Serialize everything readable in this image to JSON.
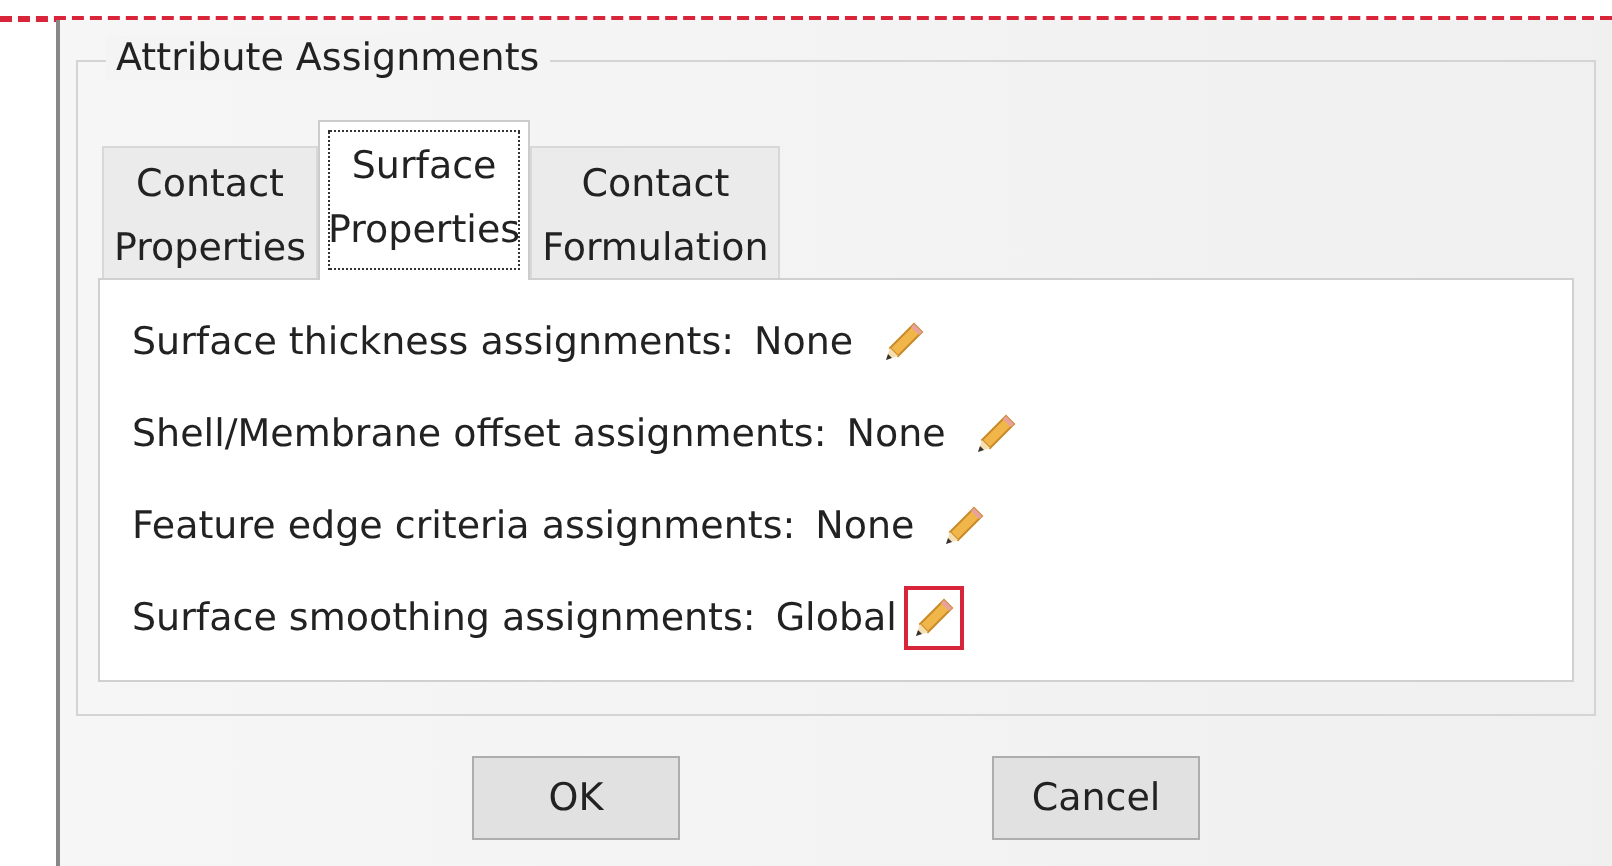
{
  "group": {
    "title": "Attribute Assignments"
  },
  "tabs": [
    {
      "label": "Contact\nProperties",
      "selected": false
    },
    {
      "label": "Surface\nProperties",
      "selected": true
    },
    {
      "label": "Contact\nFormulation",
      "selected": false
    }
  ],
  "rows": [
    {
      "label": "Surface thickness assignments:",
      "value": "None",
      "highlighted": false
    },
    {
      "label": "Shell/Membrane offset assignments:",
      "value": "None",
      "highlighted": false
    },
    {
      "label": "Feature edge criteria assignments:",
      "value": "None",
      "highlighted": false
    },
    {
      "label": "Surface smoothing assignments:",
      "value": "Global",
      "highlighted": true
    }
  ],
  "buttons": [
    "OK",
    "Cancel"
  ]
}
